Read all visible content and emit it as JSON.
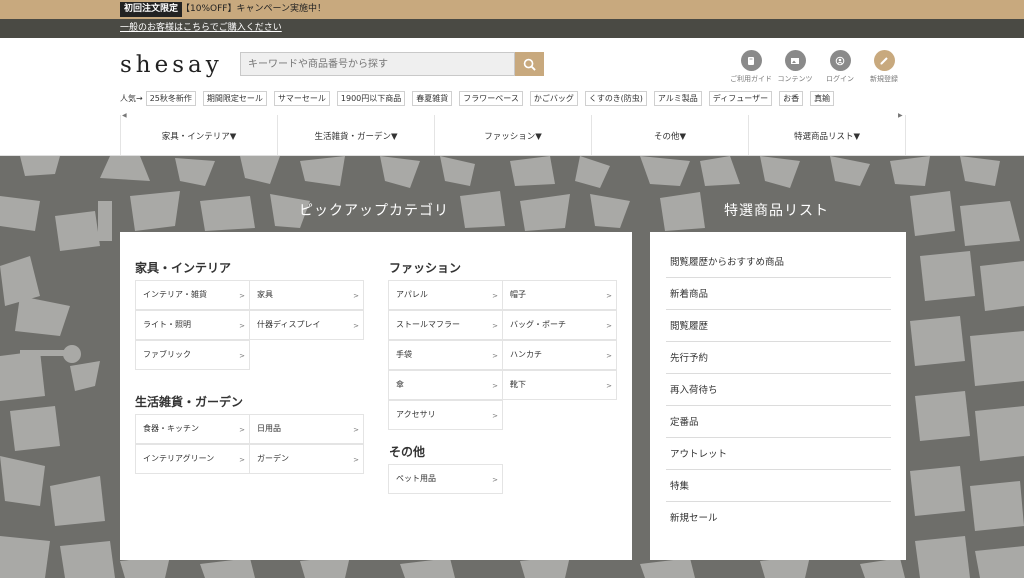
{
  "promo": {
    "badge": "初回注文限定",
    "text": "【10%OFF】キャンペーン実施中！"
  },
  "general_link": "一般のお客様はこちらでご購入ください",
  "header": {
    "logo": "shesay",
    "search": {
      "placeholder": "キーワードや商品番号から探す"
    },
    "util_links": [
      {
        "label": "ご利用ガイド",
        "icon": "book-icon"
      },
      {
        "label": "コンテンツ",
        "icon": "image-icon"
      },
      {
        "label": "ログイン",
        "icon": "user-icon"
      },
      {
        "label": "新規登録",
        "icon": "pencil-icon"
      }
    ]
  },
  "keywords": {
    "label": "人気→",
    "tags": [
      "25秋冬新作",
      "期間限定セール",
      "サマーセール",
      "1900円以下商品",
      "春夏雑貨",
      "フラワーベース",
      "かごバッグ",
      "くすのき(防虫)",
      "アルミ製品",
      "ディフューザー",
      "お香",
      "真鍮"
    ]
  },
  "category_nav": [
    "家具・インテリア▼",
    "生活雑貨・ガーデン▼",
    "ファッション▼",
    "その他▼",
    "特選商品リスト▼"
  ],
  "pickup": {
    "title": "ピックアップカテゴリ",
    "groups": [
      {
        "title": "家具・インテリア",
        "items": [
          "インテリア・雑貨",
          "家具",
          "ライト・照明",
          "什器ディスプレイ",
          "ファブリック"
        ]
      },
      {
        "title": "生活雑貨・ガーデン",
        "items": [
          "食器・キッチン",
          "日用品",
          "インテリアグリーン",
          "ガーデン"
        ]
      },
      {
        "title": "ファッション",
        "items": [
          "アパレル",
          "帽子",
          "ストールマフラー",
          "バッグ・ポーチ",
          "手袋",
          "ハンカチ",
          "傘",
          "靴下",
          "アクセサリ"
        ]
      },
      {
        "title": "その他",
        "items": [
          "ペット用品"
        ]
      }
    ]
  },
  "special": {
    "title": "特選商品リスト",
    "items": [
      "閲覧履歴からおすすめ商品",
      "新着商品",
      "閲覧履歴",
      "先行予約",
      "再入荷待ち",
      "定番品",
      "アウトレット",
      "特集",
      "新規セール"
    ]
  },
  "arrow_glyph": ">",
  "colors": {
    "accent": "#c8a97e",
    "dark_bar": "#4a4a44",
    "pattern_bg": "#6e6e6a"
  }
}
